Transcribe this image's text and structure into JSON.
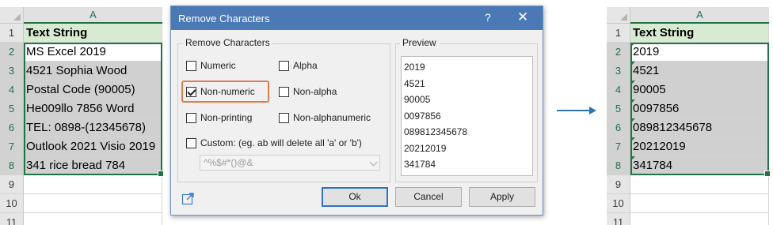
{
  "sheet": {
    "column_header": "A",
    "row_numbers": [
      "1",
      "2",
      "3",
      "4",
      "5",
      "6",
      "7",
      "8",
      "9",
      "10",
      "11"
    ],
    "header_cell": "Text String"
  },
  "left_cells": [
    "MS Excel 2019",
    "4521 Sophia Wood",
    "Postal Code (90005)",
    "He009llo 7856 Word",
    "TEL: 0898-(12345678)",
    "Outlook 2021 Visio 2019",
    "341 rice bread 784"
  ],
  "right_cells": [
    "2019",
    "4521",
    "90005",
    "0097856",
    "089812345678",
    "20212019",
    "341784"
  ],
  "dialog": {
    "title": "Remove Characters",
    "help": "?",
    "close": "✕",
    "group_label": "Remove Characters",
    "options": {
      "numeric": "Numeric",
      "alpha": "Alpha",
      "non_numeric": "Non-numeric",
      "non_alpha": "Non-alpha",
      "non_printing": "Non-printing",
      "non_alphanumeric": "Non-alphanumeric",
      "custom": "Custom: (eg. ab will delete all 'a' or 'b')"
    },
    "checked": "non_numeric",
    "custom_value": "^%$#*()@&",
    "preview_label": "Preview",
    "preview_lines": [
      "2019",
      "4521",
      "90005",
      "0097856",
      "089812345678",
      "20212019",
      "341784"
    ],
    "ok": "Ok",
    "cancel": "Cancel",
    "apply": "Apply"
  },
  "colors": {
    "excel_green": "#217346",
    "header_fill": "#d9ead3",
    "selection_fill": "#d0d0d0",
    "titlebar": "#4a79b5",
    "highlight": "#e07b4f",
    "arrow": "#2e75b6"
  },
  "icons": [
    "chevron-down-icon",
    "external-link-icon",
    "right-arrow-icon",
    "checkmark-icon",
    "close-icon",
    "help-icon"
  ]
}
